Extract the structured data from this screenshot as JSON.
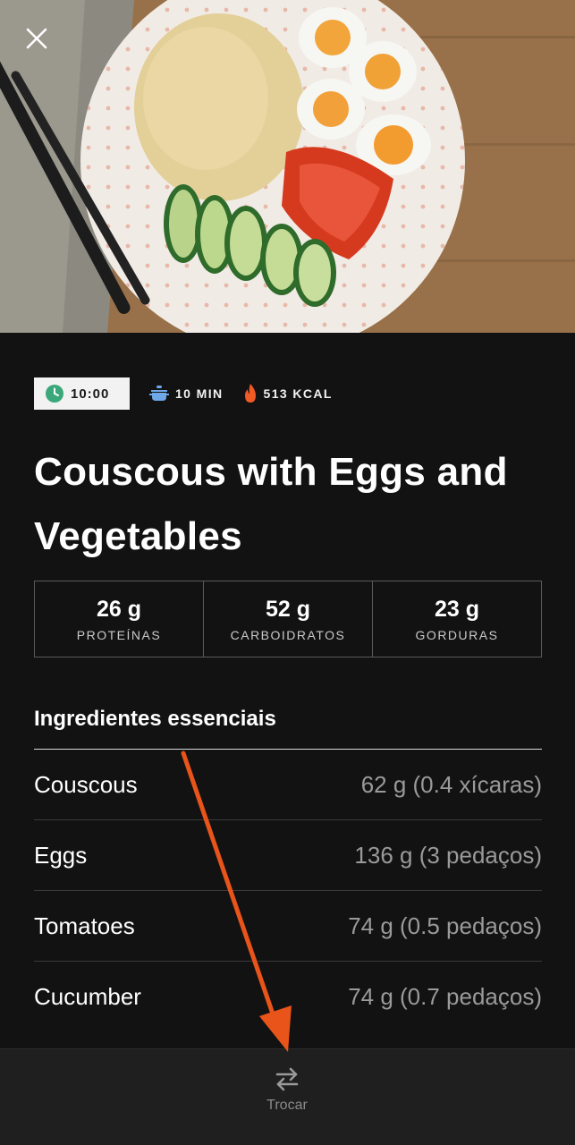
{
  "header": {
    "close_icon": "close-icon"
  },
  "meta": {
    "time": "10:00",
    "prep_time": "10 MIN",
    "calories": "513 KCAL",
    "colors": {
      "clock": "#3aa87a",
      "pot": "#6ea8e8",
      "flame": "#f05a24"
    }
  },
  "recipe": {
    "title": "Couscous with Eggs and Vegetables"
  },
  "macros": [
    {
      "value": "26 g",
      "label": "PROTEÍNAS"
    },
    {
      "value": "52 g",
      "label": "CARBOIDRATOS"
    },
    {
      "value": "23 g",
      "label": "GORDURAS"
    }
  ],
  "ingredients": {
    "heading": "Ingredientes essenciais",
    "items": [
      {
        "name": "Couscous",
        "quantity": "62 g (0.4 xícaras)"
      },
      {
        "name": "Eggs",
        "quantity": "136 g (3 pedaços)"
      },
      {
        "name": "Tomatoes",
        "quantity": "74 g (0.5 pedaços)"
      },
      {
        "name": "Cucumber",
        "quantity": "74 g (0.7 pedaços)"
      }
    ]
  },
  "bottom_bar": {
    "swap_label": "Trocar",
    "swap_icon": "swap-arrows-icon"
  },
  "annotation": {
    "arrow_color": "#e8541a"
  }
}
